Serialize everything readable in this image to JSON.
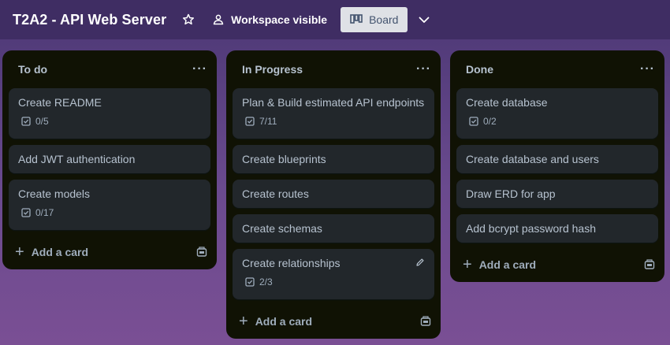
{
  "board": {
    "title": "T2A2 - API Web Server",
    "visibility_label": "Workspace visible",
    "view_label": "Board"
  },
  "lists": [
    {
      "title": "To do",
      "cards": [
        {
          "title": "Create README",
          "badge": "0/5"
        },
        {
          "title": "Add JWT authentication"
        },
        {
          "title": "Create models",
          "badge": "0/17"
        }
      ],
      "add_label": "Add a card"
    },
    {
      "title": "In Progress",
      "cards": [
        {
          "title": "Plan & Build estimated API endpoints",
          "badge": "7/11"
        },
        {
          "title": "Create blueprints"
        },
        {
          "title": "Create routes"
        },
        {
          "title": "Create schemas"
        },
        {
          "title": "Create relationships",
          "badge": "2/3"
        }
      ],
      "add_label": "Add a card"
    },
    {
      "title": "Done",
      "cards": [
        {
          "title": "Create database",
          "badge": "0/2"
        },
        {
          "title": "Create database and users"
        },
        {
          "title": "Draw ERD for app"
        },
        {
          "title": "Add bcrypt password hash"
        }
      ],
      "add_label": "Add a card"
    }
  ],
  "colors": {
    "header": "#3f2d63",
    "list_bg": "#101204",
    "card_bg": "#22272b",
    "text": "#b6c2cf"
  }
}
